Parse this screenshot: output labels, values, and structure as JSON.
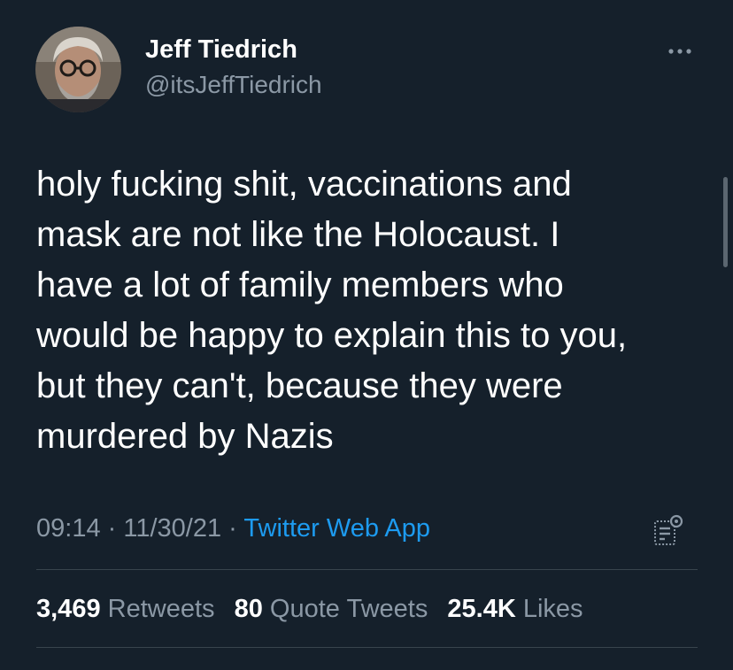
{
  "author": {
    "name": "Jeff Tiedrich",
    "handle": "@itsJeffTiedrich"
  },
  "tweet": {
    "lines": [
      "holy fucking shit, vaccinations and",
      "mask are not like the Holocaust. I",
      "have a lot of family members who",
      "would be happy to explain this to you,",
      "but they can't, because they were",
      "murdered by Nazis"
    ]
  },
  "meta": {
    "time": "09:14",
    "separator": "·",
    "date": "11/30/21",
    "source": "Twitter Web App"
  },
  "stats": {
    "retweets_count": "3,469",
    "retweets_label": "Retweets",
    "quotes_count": "80",
    "quotes_label": "Quote Tweets",
    "likes_count": "25.4K",
    "likes_label": "Likes"
  },
  "icons": {
    "more": "more-horizontal-icon",
    "analytics": "analytics-icon"
  },
  "colors": {
    "background": "#15202b",
    "secondary_text": "#8b98a5",
    "link": "#1d9bf0",
    "divider": "#38444d"
  }
}
